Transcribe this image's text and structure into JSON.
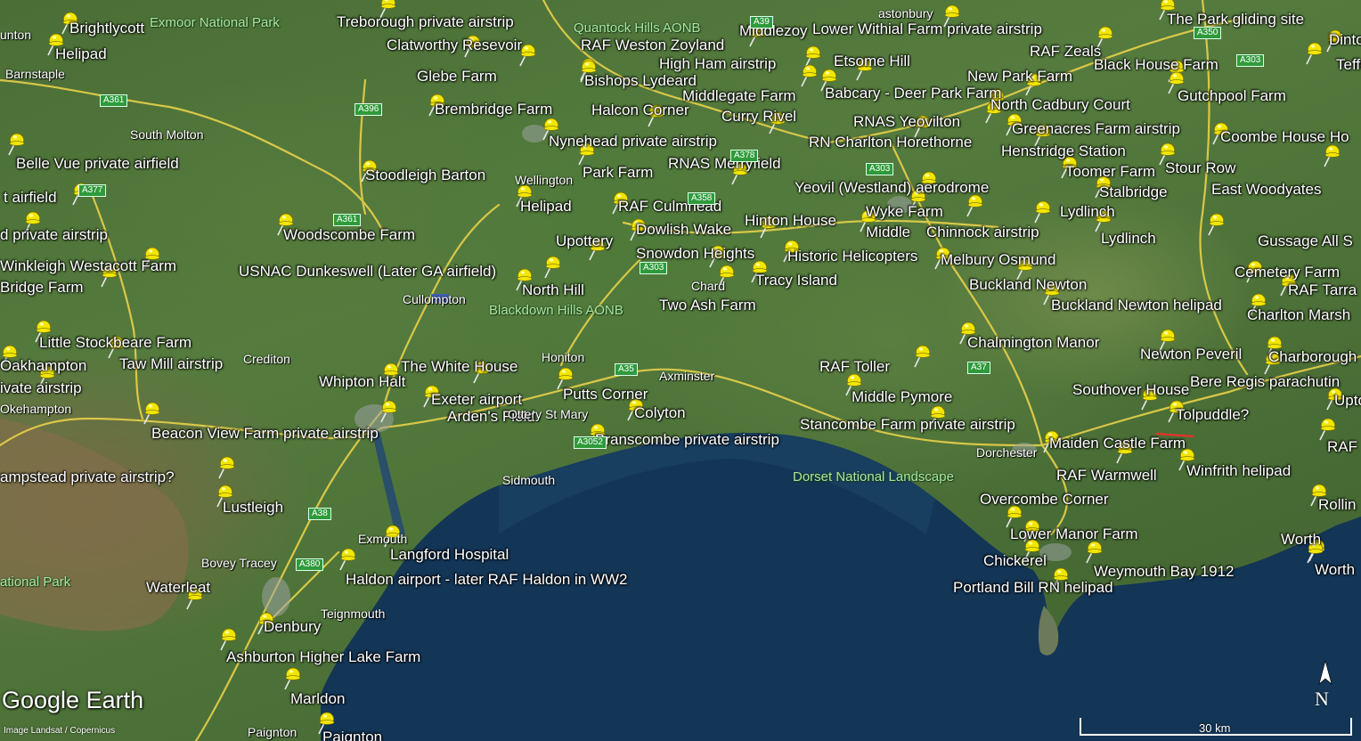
{
  "map": {
    "branding": "Google Earth",
    "imagery_credit": "Image Landsat / Copernicus",
    "scale_label": "30 km",
    "north_label": "N",
    "pin_color": "#f2e600",
    "road_color": "#f0d64a",
    "sea_color": "#0f2f4f"
  },
  "placemarks": [
    {
      "name": "Brightlycott"
    },
    {
      "name": "Helipad"
    },
    {
      "name": "Treborough private airstrip"
    },
    {
      "name": "Clatworthy Resevoir"
    },
    {
      "name": "Glebe Farm"
    },
    {
      "name": "RAF Weston Zoyland"
    },
    {
      "name": "Middlezoy"
    },
    {
      "name": "Lower Withial Farm private airstrip"
    },
    {
      "name": "The Park gliding site"
    },
    {
      "name": "Dinton"
    },
    {
      "name": "RAF Zeals"
    },
    {
      "name": "Black House Farm"
    },
    {
      "name": "Teffont"
    },
    {
      "name": "High Ham airstrip"
    },
    {
      "name": "Etsome Hill"
    },
    {
      "name": "New Park Farm"
    },
    {
      "name": "Bishops Lydeard"
    },
    {
      "name": "Middlegate Farm"
    },
    {
      "name": "Babcary - Deer Park Farm"
    },
    {
      "name": "Gutchpool Farm"
    },
    {
      "name": "Brembridge Farm"
    },
    {
      "name": "Halcon Corner"
    },
    {
      "name": "North Cadbury Court"
    },
    {
      "name": "Curry Rivel"
    },
    {
      "name": "RNAS Yeovilton"
    },
    {
      "name": "Greenacres Farm airstrip"
    },
    {
      "name": "Coombe House Ho"
    },
    {
      "name": "Nynehead private airstrip"
    },
    {
      "name": "RN Charlton Horethorne"
    },
    {
      "name": "Henstridge Station"
    },
    {
      "name": "Belle Vue private airfield"
    },
    {
      "name": "RNAS Merryfield"
    },
    {
      "name": "Stour Row"
    },
    {
      "name": "Park Farm"
    },
    {
      "name": "Toomer Farm"
    },
    {
      "name": "Stoodleigh Barton"
    },
    {
      "name": "East Woodyates"
    },
    {
      "name": "t airfield"
    },
    {
      "name": "Yeovil (Westland) aerodrome"
    },
    {
      "name": "Stalbridge"
    },
    {
      "name": "Helipad"
    },
    {
      "name": "RAF Culmhead"
    },
    {
      "name": "Wyke Farm"
    },
    {
      "name": "Lydlinch"
    },
    {
      "name": "Hinton House"
    },
    {
      "name": "Dowlish Wake"
    },
    {
      "name": "Middle"
    },
    {
      "name": "Chinnock airstrip"
    },
    {
      "name": "d private airstrip"
    },
    {
      "name": "Woodscombe Farm"
    },
    {
      "name": "Upottery"
    },
    {
      "name": "Lydlinch"
    },
    {
      "name": "Gussage All S"
    },
    {
      "name": "Snowdon Heights"
    },
    {
      "name": "Historic Helicopters"
    },
    {
      "name": "Melbury Osmund"
    },
    {
      "name": "Winkleigh Westacott Farm"
    },
    {
      "name": "USNAC Dunkeswell (Later GA airfield)"
    },
    {
      "name": "Cemetery Farm"
    },
    {
      "name": "Tracy Island"
    },
    {
      "name": "Bridge Farm"
    },
    {
      "name": "North Hill"
    },
    {
      "name": "Buckland Newton"
    },
    {
      "name": "RAF Tarra"
    },
    {
      "name": "Two Ash Farm"
    },
    {
      "name": "Buckland Newton helipad"
    },
    {
      "name": "Charlton Marsh"
    },
    {
      "name": "Little Stockbeare Farm"
    },
    {
      "name": "Chalmington Manor"
    },
    {
      "name": "Newton Peveril"
    },
    {
      "name": "Charborough"
    },
    {
      "name": "Oakhampton"
    },
    {
      "name": "Taw Mill airstrip"
    },
    {
      "name": "The White House"
    },
    {
      "name": "RAF Toller"
    },
    {
      "name": "Whipton Halt"
    },
    {
      "name": "Bere Regis parachutin"
    },
    {
      "name": "ivate airstrip"
    },
    {
      "name": "Putts Corner"
    },
    {
      "name": "Exeter airport"
    },
    {
      "name": "Middle Pymore"
    },
    {
      "name": "Southover House"
    },
    {
      "name": "Upto"
    },
    {
      "name": "Arden's Field"
    },
    {
      "name": "Colyton"
    },
    {
      "name": "Tolpuddle?"
    },
    {
      "name": "Stancombe Farm private airstrip"
    },
    {
      "name": "Beacon View Farm private airstrip"
    },
    {
      "name": "Branscombe private airstrip"
    },
    {
      "name": "Maiden Castle Farm"
    },
    {
      "name": "RAF"
    },
    {
      "name": "RAF Warmwell"
    },
    {
      "name": "Winfrith helipad"
    },
    {
      "name": "ampstead private airstrip?"
    },
    {
      "name": "Lustleigh"
    },
    {
      "name": "Overcombe Corner"
    },
    {
      "name": "Rollin"
    },
    {
      "name": "Lower Manor Farm"
    },
    {
      "name": "Worth"
    },
    {
      "name": "Langford Hospital"
    },
    {
      "name": "Chickerel"
    },
    {
      "name": "Weymouth Bay 1912"
    },
    {
      "name": "Worth"
    },
    {
      "name": "Haldon airport - later RAF Haldon in WW2"
    },
    {
      "name": "Waterleat"
    },
    {
      "name": "Portland Bill RN helipad"
    },
    {
      "name": "Denbury"
    },
    {
      "name": "Ashburton Higher Lake Farm"
    },
    {
      "name": "Marldon"
    },
    {
      "name": "Paignton"
    }
  ],
  "towns": [
    {
      "name": "unton"
    },
    {
      "name": "Barnstaple"
    },
    {
      "name": "South Molton"
    },
    {
      "name": "Wellington"
    },
    {
      "name": "Cullompton"
    },
    {
      "name": "Chard"
    },
    {
      "name": "Crediton"
    },
    {
      "name": "Honiton"
    },
    {
      "name": "Axminster"
    },
    {
      "name": "Okehampton"
    },
    {
      "name": "Ottery St Mary"
    },
    {
      "name": "Dorchester"
    },
    {
      "name": "Sidmouth"
    },
    {
      "name": "Exmouth"
    },
    {
      "name": "Bovey Tracey"
    },
    {
      "name": "Teignmouth"
    },
    {
      "name": "Paignton"
    },
    {
      "name": "astonbury"
    }
  ],
  "areas": [
    {
      "name": "Exmoor National Park"
    },
    {
      "name": "Quantock Hills AONB"
    },
    {
      "name": "Blackdown Hills AONB"
    },
    {
      "name": "Dorset National Landscape"
    },
    {
      "name": "ational Park"
    }
  ],
  "roads": [
    {
      "name": "A39"
    },
    {
      "name": "A361"
    },
    {
      "name": "A396"
    },
    {
      "name": "A377"
    },
    {
      "name": "A361"
    },
    {
      "name": "A38"
    },
    {
      "name": "A303"
    },
    {
      "name": "A358"
    },
    {
      "name": "A35"
    },
    {
      "name": "A37"
    },
    {
      "name": "A350"
    },
    {
      "name": "A303"
    },
    {
      "name": "A380"
    },
    {
      "name": "A3052"
    },
    {
      "name": "A378"
    },
    {
      "name": "A303"
    }
  ]
}
